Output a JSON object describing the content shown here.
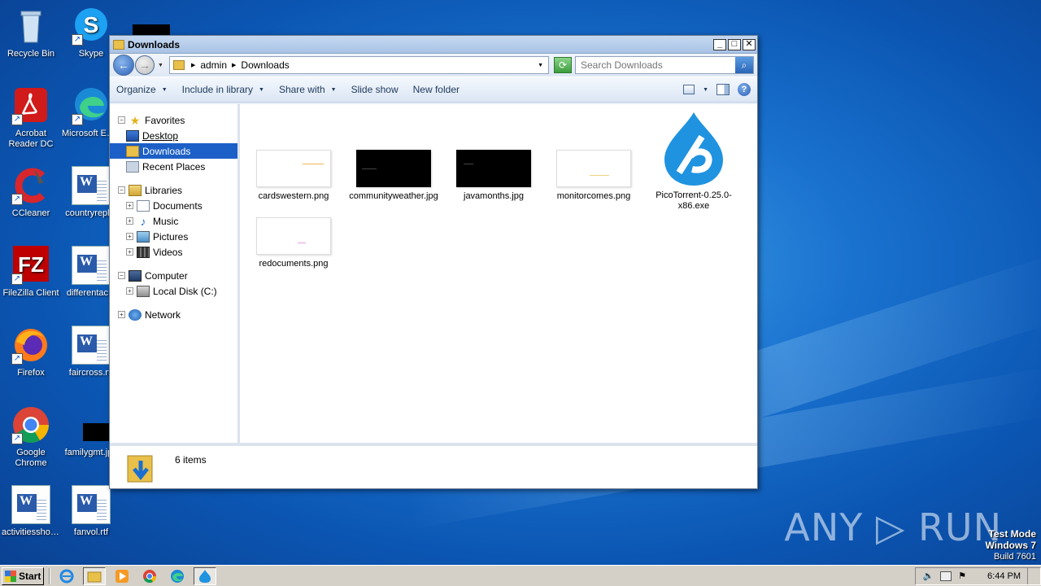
{
  "desktop": {
    "icons": [
      {
        "label": "Recycle Bin"
      },
      {
        "label": "Skype"
      },
      {
        "label": "Acrobat Reader DC"
      },
      {
        "label": "Microsoft Edge"
      },
      {
        "label": "CCleaner"
      },
      {
        "label": "countryrepl..."
      },
      {
        "label": "FileZilla Client"
      },
      {
        "label": "differentac..."
      },
      {
        "label": "Firefox"
      },
      {
        "label": "faircross.rtf"
      },
      {
        "label": "Google Chrome"
      },
      {
        "label": "familygmt.jpg"
      },
      {
        "label": "activitiesshot..."
      },
      {
        "label": "fanvol.rtf"
      }
    ]
  },
  "window": {
    "title": "Downloads",
    "controls": {
      "minimize": "_",
      "maximize": "□",
      "close": "✕"
    },
    "address": {
      "crumbs": [
        "admin",
        "Downloads"
      ]
    },
    "search": {
      "placeholder": "Search Downloads"
    },
    "toolbar": {
      "organize": "Organize",
      "include_in_library": "Include in library",
      "share_with": "Share with",
      "slide_show": "Slide show",
      "new_folder": "New folder",
      "help": "?"
    },
    "nav": {
      "favorites": "Favorites",
      "desktop": "Desktop",
      "downloads": "Downloads",
      "recent_places": "Recent Places",
      "libraries": "Libraries",
      "documents": "Documents",
      "music": "Music",
      "pictures": "Pictures",
      "videos": "Videos",
      "computer": "Computer",
      "local_disk": "Local Disk (C:)",
      "network": "Network"
    },
    "files": [
      {
        "name": "cardswestern.png",
        "thumb": "white",
        "mark": "#f2b45a"
      },
      {
        "name": "communityweather.jpg",
        "thumb": "black",
        "mark": "#444444"
      },
      {
        "name": "javamonths.jpg",
        "thumb": "black",
        "mark": "#444444"
      },
      {
        "name": "monitorcomes.png",
        "thumb": "white",
        "mark": "#f0d080"
      },
      {
        "name": "PicoTorrent-0.25.0-x86.exe",
        "thumb": "pico",
        "mark": "#1f93e0"
      },
      {
        "name": "redocuments.png",
        "thumb": "white",
        "mark": "#e8a0e8"
      }
    ],
    "status": {
      "count": "6 items"
    }
  },
  "taskbar": {
    "start": "Start",
    "clock": "6:44 PM"
  },
  "watermark": "ANY ▷ RUN",
  "os": {
    "line1": "Test Mode",
    "line2": "Windows 7",
    "line3": "Build 7601"
  }
}
